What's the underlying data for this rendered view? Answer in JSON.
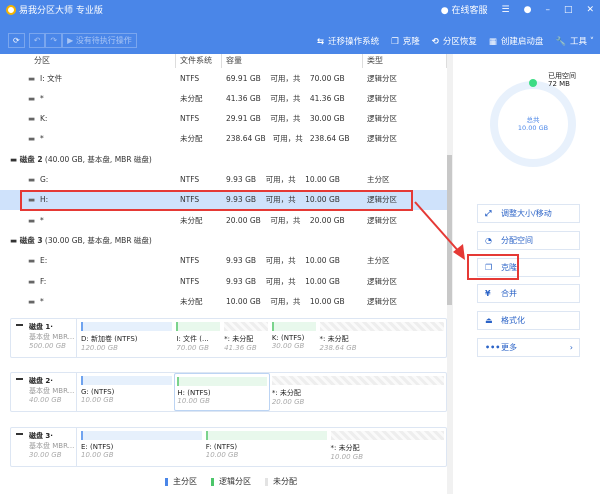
{
  "app": {
    "title": "易我分区大师 专业版",
    "support": "在线客服"
  },
  "toolbar": {
    "pending": "没有待执行操作",
    "actions": [
      {
        "icon": "migrate-icon",
        "label": "迁移操作系统"
      },
      {
        "icon": "clone-icon",
        "label": "克隆"
      },
      {
        "icon": "recovery-icon",
        "label": "分区恢复"
      },
      {
        "icon": "bootdisk-icon",
        "label": "创建启动盘"
      },
      {
        "icon": "wrench-icon",
        "label": "工具"
      }
    ]
  },
  "table": {
    "headers": [
      "分区",
      "文件系统",
      "容量",
      "类型"
    ],
    "items": [
      {
        "kind": "row",
        "name": "I: 文件",
        "fs": "NTFS",
        "cap": "69.91 GB    可用，共    70.00 GB",
        "type": "逻辑分区"
      },
      {
        "kind": "row",
        "name": "*",
        "fs": "未分配",
        "cap": "41.36 GB    可用，共    41.36 GB",
        "type": "逻辑分区"
      },
      {
        "kind": "row",
        "name": "K:",
        "fs": "NTFS",
        "cap": "29.91 GB    可用，共    30.00 GB",
        "type": "逻辑分区"
      },
      {
        "kind": "row",
        "name": "*",
        "fs": "未分配",
        "cap": "238.64 GB   可用，共   238.64 GB",
        "type": "逻辑分区"
      },
      {
        "kind": "disk",
        "name": "磁盘 2",
        "info": " (40.00 GB, 基本盘, MBR 磁盘)"
      },
      {
        "kind": "row",
        "name": "G:",
        "fs": "NTFS",
        "cap": "9.93 GB    可用，共    10.00 GB",
        "type": "主分区"
      },
      {
        "kind": "row",
        "name": "H:",
        "fs": "NTFS",
        "cap": "9.93 GB    可用，共    10.00 GB",
        "type": "逻辑分区",
        "selected": true
      },
      {
        "kind": "row",
        "name": "*",
        "fs": "未分配",
        "cap": "20.00 GB    可用，共    20.00 GB",
        "type": "逻辑分区"
      },
      {
        "kind": "disk",
        "name": "磁盘 3",
        "info": " (30.00 GB, 基本盘, MBR 磁盘)"
      },
      {
        "kind": "row",
        "name": "E:",
        "fs": "NTFS",
        "cap": "9.93 GB    可用，共    10.00 GB",
        "type": "主分区"
      },
      {
        "kind": "row",
        "name": "F:",
        "fs": "NTFS",
        "cap": "9.93 GB    可用，共    10.00 GB",
        "type": "逻辑分区"
      },
      {
        "kind": "row",
        "name": "*",
        "fs": "未分配",
        "cap": "10.00 GB    可用，共    10.00 GB",
        "type": "逻辑分区"
      }
    ]
  },
  "maps": [
    {
      "name": "磁盘 1·",
      "type": "基本盘 MBR...",
      "size": "500.00 GB",
      "parts": [
        {
          "k": "p",
          "n": "D: 新加卷 (NTFS)",
          "s": "120.00 GB",
          "w": 26
        },
        {
          "k": "l",
          "n": "I: 文件 (...",
          "s": "70.00 GB",
          "w": 13
        },
        {
          "k": "u",
          "n": "*: 未分配",
          "s": "41.36 GB",
          "w": 13
        },
        {
          "k": "l",
          "n": "K: (NTFS)",
          "s": "30.00 GB",
          "w": 13
        },
        {
          "k": "u",
          "n": "*: 未分配",
          "s": "238.64 GB",
          "w": 35
        }
      ]
    },
    {
      "name": "磁盘 2·",
      "type": "基本盘 MBR...",
      "size": "40.00 GB",
      "parts": [
        {
          "k": "p",
          "n": "G: (NTFS)",
          "s": "10.00 GB",
          "w": 26
        },
        {
          "k": "l",
          "n": "H: (NTFS)",
          "s": "10.00 GB",
          "w": 26,
          "hl": true
        },
        {
          "k": "u",
          "n": "*: 未分配",
          "s": "20.00 GB",
          "w": 48
        }
      ]
    },
    {
      "name": "磁盘 3·",
      "type": "基本盘 MBR...",
      "size": "30.00 GB",
      "parts": [
        {
          "k": "p",
          "n": "E: (NTFS)",
          "s": "10.00 GB",
          "w": 34
        },
        {
          "k": "l",
          "n": "F: (NTFS)",
          "s": "10.00 GB",
          "w": 34
        },
        {
          "k": "u",
          "n": "*: 未分配",
          "s": "10.00 GB",
          "w": 32
        }
      ]
    }
  ],
  "legend": {
    "primary": "主分区",
    "logical": "逻辑分区",
    "unalloc": "未分配"
  },
  "side": {
    "used_label": "已用空间",
    "used": "72 MB",
    "total_label": "总共",
    "total": "10.00 GB",
    "used_fraction": 0.007,
    "actions": [
      "调整大小/移动",
      "分配空间",
      "克隆",
      "合并",
      "格式化",
      "更多"
    ]
  },
  "colors": {
    "accent": "#4a86e8",
    "highlight": "#e53935"
  }
}
